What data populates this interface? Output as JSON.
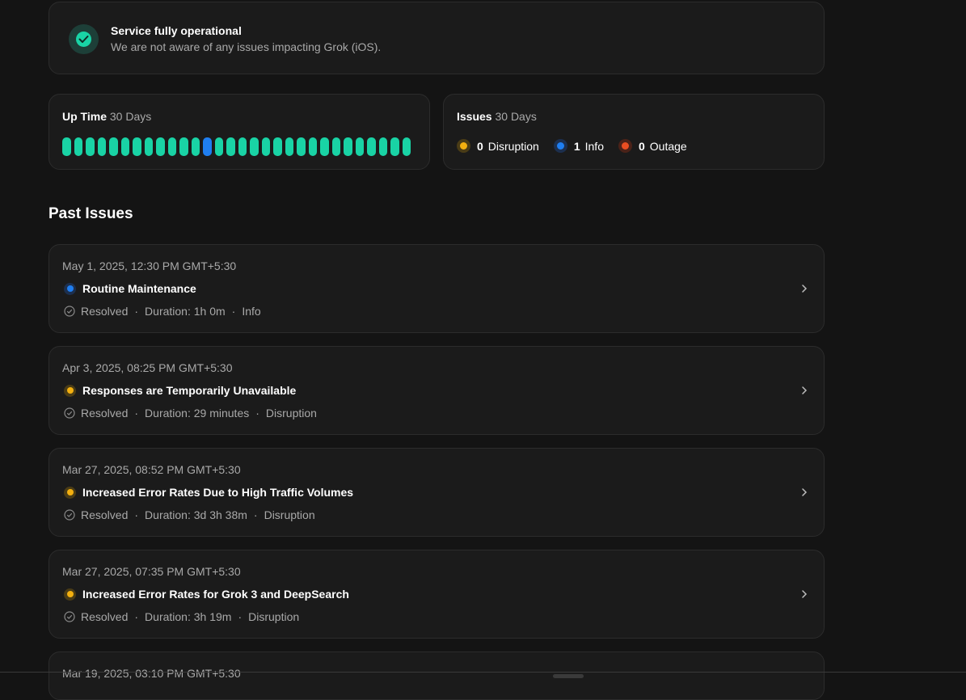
{
  "status": {
    "title": "Service fully operational",
    "description": "We are not aware of any issues impacting Grok (iOS).",
    "icon": "check-circle-icon",
    "color": "#19d3a5"
  },
  "uptime": {
    "title": "Up Time",
    "period": "30 Days",
    "days": [
      "ok",
      "ok",
      "ok",
      "ok",
      "ok",
      "ok",
      "ok",
      "ok",
      "ok",
      "ok",
      "ok",
      "ok",
      "info",
      "ok",
      "ok",
      "ok",
      "ok",
      "ok",
      "ok",
      "ok",
      "ok",
      "ok",
      "ok",
      "ok",
      "ok",
      "ok",
      "ok",
      "ok",
      "ok",
      "ok"
    ]
  },
  "issues_summary": {
    "title": "Issues",
    "period": "30 Days",
    "stats": [
      {
        "count": "0",
        "label": "Disruption",
        "color": "#f3b010"
      },
      {
        "count": "1",
        "label": "Info",
        "color": "#1f7ef0"
      },
      {
        "count": "0",
        "label": "Outage",
        "color": "#ea4e22"
      }
    ]
  },
  "past_issues": {
    "title": "Past Issues",
    "items": [
      {
        "date": "May 1, 2025, 12:30 PM GMT+5:30",
        "title": "Routine Maintenance",
        "status": "Resolved",
        "duration": "Duration: 1h 0m",
        "type": "Info",
        "color": "blue"
      },
      {
        "date": "Apr 3, 2025, 08:25 PM GMT+5:30",
        "title": "Responses are Temporarily Unavailable",
        "status": "Resolved",
        "duration": "Duration: 29 minutes",
        "type": "Disruption",
        "color": "yellow"
      },
      {
        "date": "Mar 27, 2025, 08:52 PM GMT+5:30",
        "title": "Increased Error Rates Due to High Traffic Volumes",
        "status": "Resolved",
        "duration": "Duration: 3d 3h 38m",
        "type": "Disruption",
        "color": "yellow"
      },
      {
        "date": "Mar 27, 2025, 07:35 PM GMT+5:30",
        "title": "Increased Error Rates for Grok 3 and DeepSearch",
        "status": "Resolved",
        "duration": "Duration: 3h 19m",
        "type": "Disruption",
        "color": "yellow"
      },
      {
        "date": "Mar 19, 2025, 03:10 PM GMT+5:30",
        "title": "",
        "status": "",
        "duration": "",
        "type": "",
        "color": "yellow"
      }
    ]
  }
}
